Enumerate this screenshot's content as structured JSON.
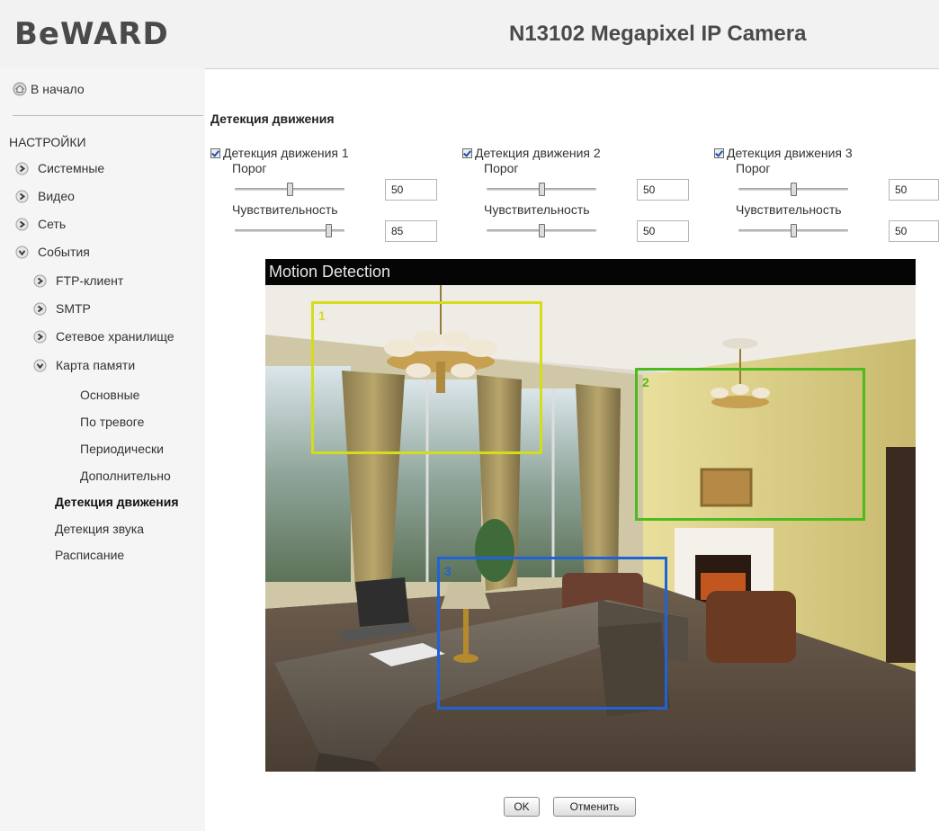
{
  "header": {
    "logo_text": "BeWARD",
    "title": "N13102 Megapixel IP Camera"
  },
  "sidebar": {
    "home_label": "В начало",
    "section_title": "НАСТРОЙКИ",
    "items": [
      {
        "label": "Системные"
      },
      {
        "label": "Видео"
      },
      {
        "label": "Сеть"
      },
      {
        "label": "События"
      }
    ],
    "event_items": [
      {
        "label": "FTP-клиент"
      },
      {
        "label": "SMTP"
      },
      {
        "label": "Сетевое хранилище"
      },
      {
        "label": "Карта памяти"
      }
    ],
    "memory_items": [
      {
        "label": "Основные"
      },
      {
        "label": "По тревоге"
      },
      {
        "label": "Периодически"
      },
      {
        "label": "Дополнительно"
      }
    ],
    "bottom_items": [
      {
        "label": "Детекция движения",
        "active": true
      },
      {
        "label": "Детекция звука"
      },
      {
        "label": "Расписание"
      }
    ]
  },
  "main": {
    "heading": "Детекция движения",
    "detectors": [
      {
        "label": "Детекция движения 1",
        "checked": true,
        "threshold_label": "Порог",
        "threshold": "50",
        "threshold_level": 0.5,
        "sensitivity_label": "Чувствительность",
        "sensitivity": "85",
        "sensitivity_level": 0.85
      },
      {
        "label": "Детекция движения 2",
        "checked": true,
        "threshold_label": "Порог",
        "threshold": "50",
        "threshold_level": 0.5,
        "sensitivity_label": "Чувствительность",
        "sensitivity": "50",
        "sensitivity_level": 0.5
      },
      {
        "label": "Детекция движения 3",
        "checked": true,
        "threshold_label": "Порог",
        "threshold": "50",
        "threshold_level": 0.5,
        "sensitivity_label": "Чувствительность",
        "sensitivity": "50",
        "sensitivity_level": 0.5
      }
    ],
    "video": {
      "title": "Motion Detection",
      "zones": [
        {
          "label": "1",
          "color": "#d4dd1a"
        },
        {
          "label": "2",
          "color": "#4dbb1c"
        },
        {
          "label": "3",
          "color": "#1f63d6"
        }
      ]
    },
    "buttons": {
      "ok": "OK",
      "cancel": "Отменить"
    }
  },
  "colors": {
    "header_bg": "#f2f2f2",
    "sidebar_bg": "#f5f5f5",
    "video_title_bg": "#050505"
  }
}
